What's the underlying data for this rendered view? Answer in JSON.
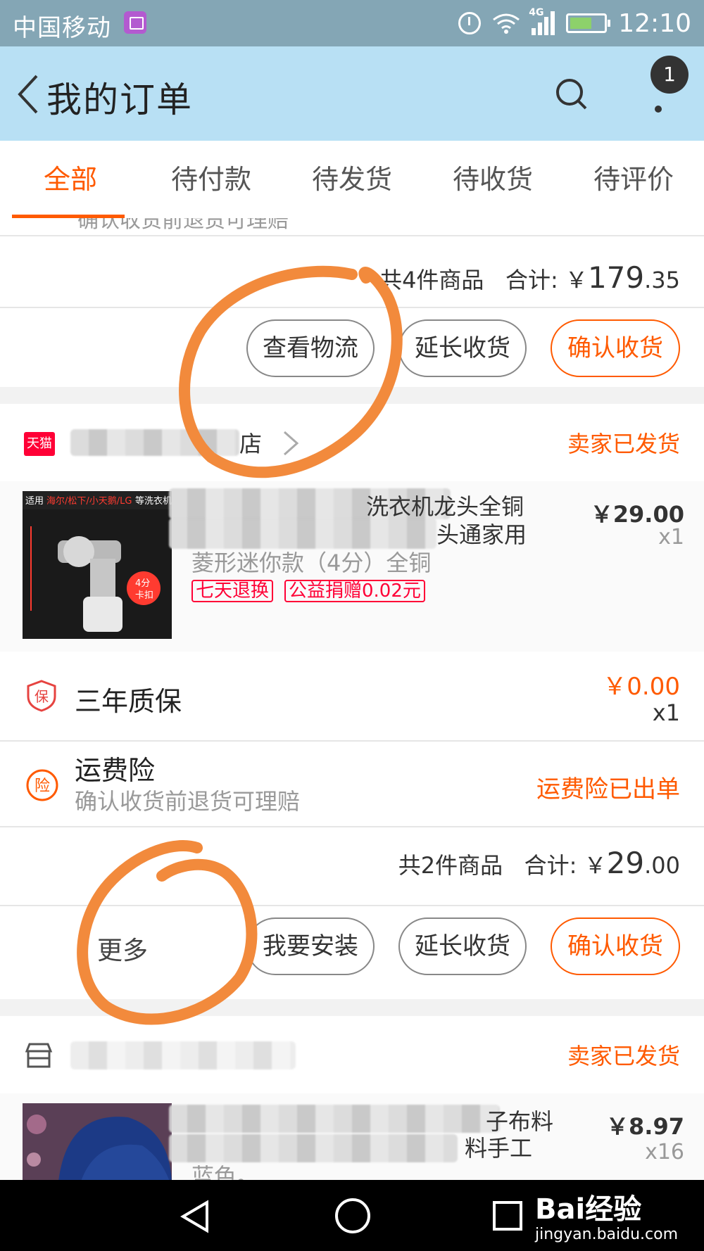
{
  "status_bar": {
    "carrier": "中国移动",
    "network": "4G",
    "time": "12:10"
  },
  "header": {
    "back_icon": "back-chevron-icon",
    "title": "我的订单",
    "badge_count": "1"
  },
  "tabs": [
    {
      "label": "全部",
      "active": true
    },
    {
      "label": "待付款",
      "active": false
    },
    {
      "label": "待发货",
      "active": false
    },
    {
      "label": "待收货",
      "active": false
    },
    {
      "label": "待评价",
      "active": false
    }
  ],
  "order1": {
    "faded_line": "确认收货前退货可理赔",
    "summary_count": "共4件商品",
    "summary_label": "合计:",
    "currency": "￥",
    "total_int": "179",
    "total_dec": ".35",
    "buttons": {
      "logistics": "查看物流",
      "extend": "延长收货",
      "confirm": "确认收货"
    }
  },
  "order2": {
    "shop_badge": "天猫",
    "shop_name_visible": "店",
    "status": "卖家已发货",
    "product": {
      "line1": "洗衣机龙头全铜",
      "line2": "头通家用",
      "variant": "菱形迷你款（4分）全铜",
      "tag_return": "七天退换",
      "tag_charity": "公益捐赠0.02元",
      "price": "￥29.00",
      "qty": "x1"
    },
    "warranty": {
      "icon_label": "保",
      "title": "三年质保",
      "price": "￥0.00",
      "qty": "x1"
    },
    "insurance": {
      "icon_label": "险",
      "title": "运费险",
      "subtitle": "确认收货前退货可理赔",
      "status": "运费险已出单"
    },
    "summary_count": "共2件商品",
    "summary_label": "合计:",
    "currency": "￥",
    "total_int": "29",
    "total_dec": ".00",
    "buttons": {
      "more": "更多",
      "install": "我要安装",
      "extend": "延长收货",
      "confirm": "确认收货"
    }
  },
  "order3": {
    "status": "卖家已发货",
    "product": {
      "line1": "子布料",
      "line2": "料手工",
      "variant": "蓝色。",
      "price": "￥8.97",
      "qty": "x16"
    }
  },
  "watermark": {
    "brand": "Bai经验",
    "url": "jingyan.baidu.com"
  },
  "colors": {
    "accent": "#ff5a00",
    "header_bg": "#b8e0f4",
    "statusbar_bg": "#84a6b5",
    "tmall_red": "#ff0036",
    "annotation": "#f28a3c"
  }
}
